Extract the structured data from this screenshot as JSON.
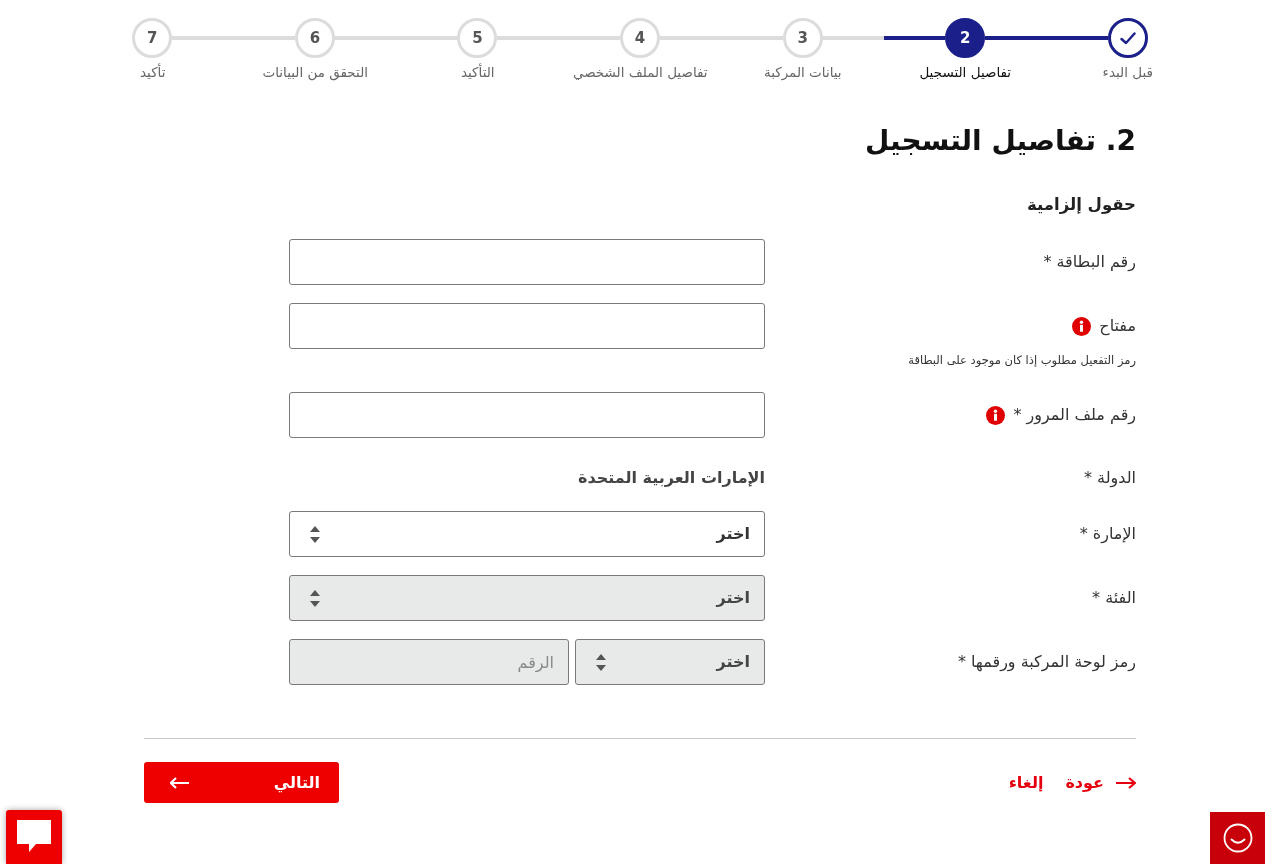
{
  "steps": [
    {
      "label": "قبل البدء",
      "done": true,
      "selected": false
    },
    {
      "number": "2",
      "label": "تفاصيل التسجيل",
      "done": false,
      "selected": true
    },
    {
      "number": "3",
      "label": "بيانات المركبة",
      "done": false,
      "selected": false
    },
    {
      "number": "4",
      "label": "تفاصيل الملف الشخصي",
      "done": false,
      "selected": false
    },
    {
      "number": "5",
      "label": "التأكيد",
      "done": false,
      "selected": false
    },
    {
      "number": "6",
      "label": "التحقق من البيانات",
      "done": false,
      "selected": false
    },
    {
      "number": "7",
      "label": "تأكيد",
      "done": false,
      "selected": false
    }
  ],
  "form": {
    "title": "2. تفاصيل التسجيل",
    "required_note": "حقول إلزامية",
    "fields": [
      {
        "kind": "text",
        "label": "رقم البطاقة *",
        "disabled": false
      },
      {
        "kind": "text",
        "label": "مفتاح",
        "info": true,
        "hint": "رمز التفعيل مطلوب إذا كان موجود على البطاقة",
        "disabled": false
      },
      {
        "kind": "text",
        "label": "رقم ملف المرور *",
        "info": true,
        "disabled": false
      },
      {
        "kind": "static",
        "label": "الدولة *",
        "value": "الإمارات العربية المتحدة"
      },
      {
        "kind": "select",
        "label": "الإمارة *",
        "value": "اختر",
        "disabled": false
      },
      {
        "kind": "select",
        "label": "الفئة *",
        "value": "اختر",
        "disabled": true
      },
      {
        "kind": "pair",
        "label": "رمز لوحة المركبة ورقمها *",
        "select": {
          "value": "اختر",
          "disabled": true
        },
        "input": {
          "placeholder": "الرقم",
          "disabled": true
        }
      }
    ]
  },
  "actions": {
    "back": "عودة",
    "cancel": "إلغاء",
    "next": "التالي"
  }
}
